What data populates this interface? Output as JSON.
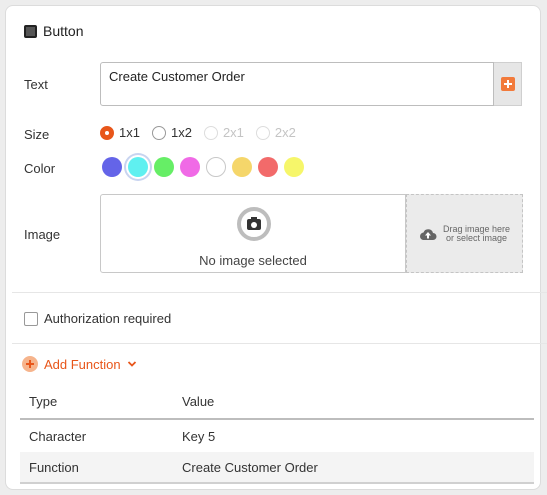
{
  "header": {
    "title": "Button"
  },
  "text": {
    "label": "Text",
    "value": "Create Customer Order"
  },
  "size": {
    "label": "Size",
    "options": [
      {
        "label": "1x1",
        "selected": true,
        "disabled": false
      },
      {
        "label": "1x2",
        "selected": false,
        "disabled": false
      },
      {
        "label": "2x1",
        "selected": false,
        "disabled": true
      },
      {
        "label": "2x2",
        "selected": false,
        "disabled": true
      }
    ]
  },
  "color": {
    "label": "Color",
    "swatches": [
      "#6464e8",
      "#5ff0f0",
      "#66ee66",
      "#f06ae6",
      "#ffffff",
      "#f5d66a",
      "#f26a6a",
      "#f6f66a"
    ],
    "selected_index": 1
  },
  "image": {
    "label": "Image",
    "placeholder": "No image selected",
    "drop_text_line1": "Drag image here",
    "drop_text_line2": "or select image"
  },
  "authorization": {
    "label": "Authorization required",
    "checked": false
  },
  "add_function": {
    "label": "Add Function"
  },
  "table": {
    "headers": [
      "Type",
      "Value"
    ],
    "rows": [
      [
        "Character",
        "Key 5"
      ],
      [
        "Function",
        "Create Customer Order"
      ]
    ]
  }
}
